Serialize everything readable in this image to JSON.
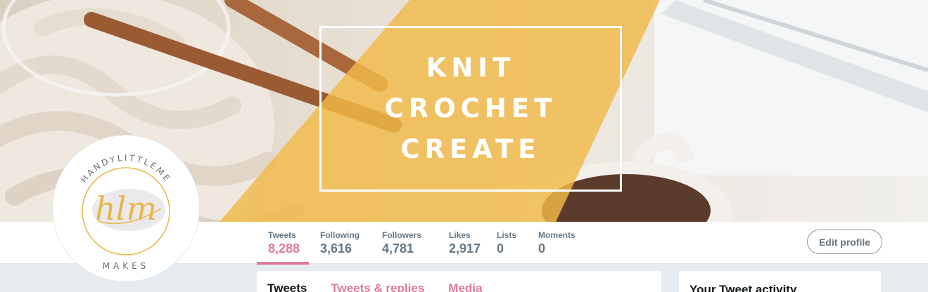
{
  "banner": {
    "lines": [
      "KNIT",
      "CROCHET",
      "CREATE"
    ]
  },
  "avatar": {
    "top_text": "HANDYLITTLEME",
    "monogram": "hlm",
    "bottom_text": "MAKES"
  },
  "stats": [
    {
      "label": "Tweets",
      "value": "8,288",
      "active": true
    },
    {
      "label": "Following",
      "value": "3,616"
    },
    {
      "label": "Followers",
      "value": "4,781"
    },
    {
      "label": "Likes",
      "value": "2,917"
    },
    {
      "label": "Lists",
      "value": "0"
    },
    {
      "label": "Moments",
      "value": "0"
    }
  ],
  "edit_profile_label": "Edit profile",
  "timeline_tabs": [
    {
      "label": "Tweets",
      "active": true
    },
    {
      "label": "Tweets & replies"
    },
    {
      "label": "Media"
    }
  ],
  "sidebar": {
    "activity_title": "Your Tweet activity"
  },
  "colors": {
    "accent": "#e0799a",
    "banner_overlay": "#f2b948",
    "stat_text": "#657786"
  }
}
